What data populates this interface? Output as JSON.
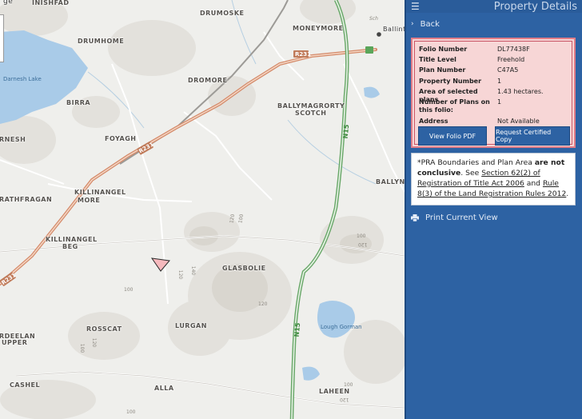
{
  "map": {
    "places": [
      {
        "name": "INISHFAD"
      },
      {
        "name": "DRUMOSKE"
      },
      {
        "name": "MONEYMORE"
      },
      {
        "name": "DRUMHOME"
      },
      {
        "name": "DROMORE"
      },
      {
        "name": "BIRRA"
      },
      {
        "name": "BALLYMAGRORTY"
      },
      {
        "name": "SCOTCH"
      },
      {
        "name": "FOYAGH"
      },
      {
        "name": "RNESH"
      },
      {
        "name": "KILLINANGEL"
      },
      {
        "name": "MORE"
      },
      {
        "name": "RATHFRAGAN"
      },
      {
        "name": "KILLINANGEL"
      },
      {
        "name": "BEG"
      },
      {
        "name": "GLASBOLIE"
      },
      {
        "name": "LURGAN"
      },
      {
        "name": "ROSSCAT"
      },
      {
        "name": "RDEELAN"
      },
      {
        "name": "UPPER"
      },
      {
        "name": "CASHEL"
      },
      {
        "name": "ALLA"
      },
      {
        "name": "LAHEEN"
      },
      {
        "name": "BALLYN"
      }
    ],
    "water_labels": [
      "Darnesh Lake",
      "Lough Gorman"
    ],
    "road_labels": [
      "R231",
      "R231",
      "R231"
    ],
    "national_road": [
      "N15",
      "N15"
    ],
    "town_label": "Ballint",
    "small_label": "Sch",
    "corner_text": "ge",
    "contours": [
      "120",
      "100",
      "100",
      "120",
      "140",
      "120",
      "120",
      "100",
      "120",
      "100",
      "100",
      "120",
      "100"
    ]
  },
  "panel": {
    "menu_icon": "hamburger-icon",
    "title": "Property Details",
    "back_label": "Back",
    "folio": {
      "rows": [
        {
          "key": "Folio Number",
          "value": "DL77438F"
        },
        {
          "key": "Title Level",
          "value": "Freehold"
        },
        {
          "key": "Plan Number",
          "value": "C47A5"
        },
        {
          "key": "Property Number",
          "value": "1"
        },
        {
          "key": "Area of selected plans",
          "value": "1.43 hectares."
        },
        {
          "key": "Number of Plans on this folio:",
          "value": "1"
        },
        {
          "key": "Address",
          "value": "Not Available"
        }
      ],
      "view_pdf_label": "View Folio PDF",
      "certified_copy_label": "Request Certified Copy"
    },
    "note": {
      "prefix": "*PRA Boundaries and Plan Area ",
      "bold": "are not conclusive",
      "middle": ". See ",
      "link1": "Section 62(2) of Registration of Title Act 2006",
      "and": " and ",
      "link2": "Rule 8(3) of the Land Registration Rules 2012",
      "suffix": "."
    },
    "print_label": "Print Current View",
    "colors": {
      "panel": "#2d62a3",
      "folio_bg": "#f7d6d6",
      "folio_border": "#e07d88",
      "button": "#2d62a3"
    }
  }
}
